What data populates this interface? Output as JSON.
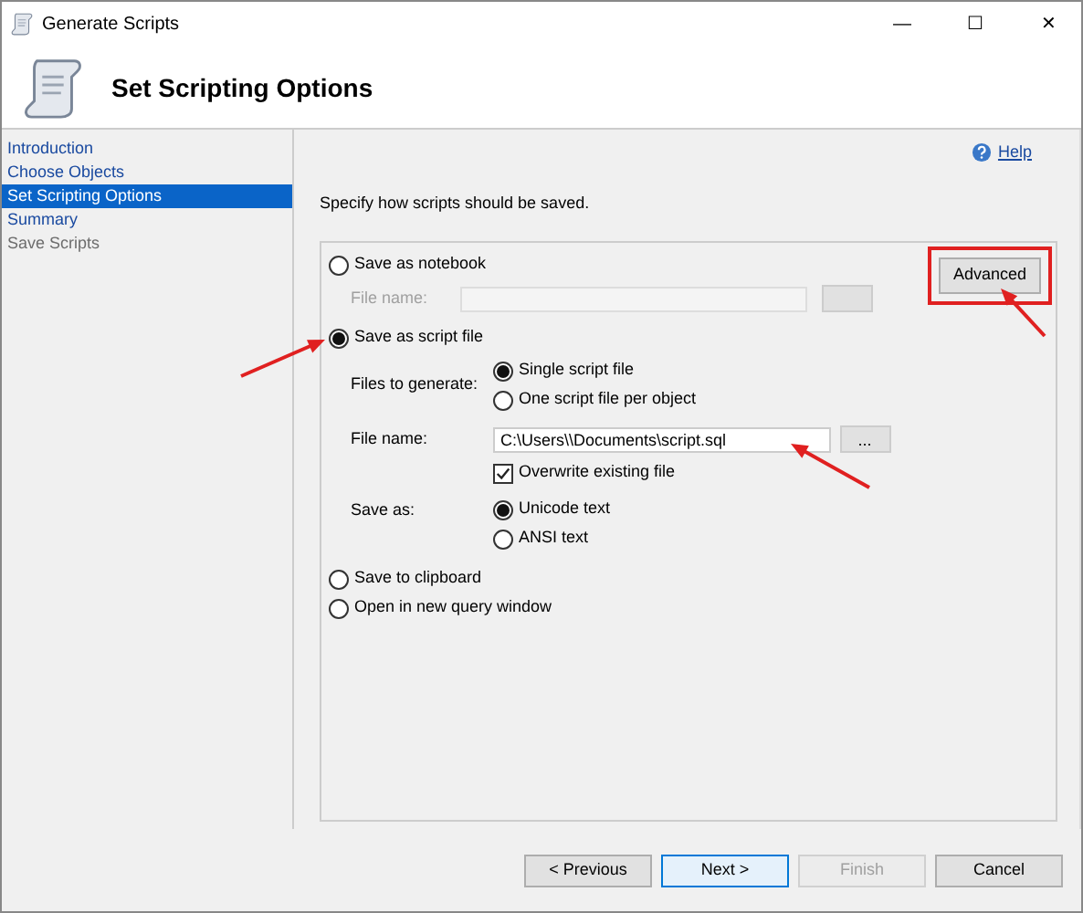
{
  "window": {
    "title": "Generate Scripts",
    "controls": [
      "—",
      "☐",
      "✕"
    ]
  },
  "header": {
    "title": "Set Scripting Options"
  },
  "sidebar": {
    "items": [
      {
        "label": "Introduction",
        "selected": false,
        "disabled": false
      },
      {
        "label": "Choose Objects",
        "selected": false,
        "disabled": false
      },
      {
        "label": "Set Scripting Options",
        "selected": true,
        "disabled": false
      },
      {
        "label": "Summary",
        "selected": false,
        "disabled": false
      },
      {
        "label": "Save Scripts",
        "selected": false,
        "disabled": true
      }
    ]
  },
  "help": {
    "label": "Help"
  },
  "instruction": "Specify how scripts should be saved.",
  "advanced_button": {
    "label": "Advanced",
    "highlighted": true
  },
  "destinations": [
    {
      "kind": "notebook",
      "label": "Save as notebook",
      "selected": false,
      "file_name_label": "File name:"
    },
    {
      "kind": "script_file",
      "label": "Save as script file",
      "selected": true,
      "files_to_generate": {
        "label": "Files to generate:",
        "options": [
          {
            "label": "Single script file",
            "selected": true
          },
          {
            "label": "One script file per object",
            "selected": false
          }
        ]
      },
      "file_name": {
        "label": "File name:",
        "value": "C:\\Users\\\\Documents\\script.sql",
        "browse": "..."
      },
      "overwrite": {
        "label": "Overwrite existing file",
        "checked": true
      },
      "save_as": {
        "label": "Save as:",
        "options": [
          {
            "label": "Unicode text",
            "selected": true
          },
          {
            "label": "ANSI text",
            "selected": false
          }
        ]
      }
    },
    {
      "kind": "plain",
      "label": "Save to clipboard",
      "selected": false
    },
    {
      "kind": "plain",
      "label": "Open in new query window",
      "selected": false
    }
  ],
  "buttons": [
    {
      "label": "< Previous",
      "disabled": false,
      "default": false
    },
    {
      "label": "Next >",
      "disabled": false,
      "default": true
    },
    {
      "label": "Finish",
      "disabled": true,
      "default": false
    },
    {
      "label": "Cancel",
      "disabled": false,
      "default": false
    }
  ]
}
